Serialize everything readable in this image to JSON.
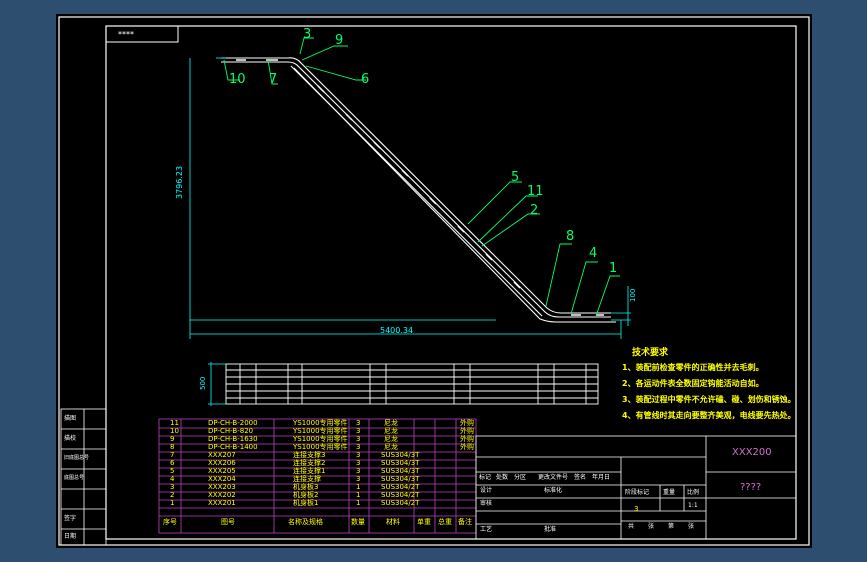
{
  "title_strip": "****",
  "dimensions": {
    "height": "3796.23",
    "length": "5400.34",
    "small_height": "100",
    "width": "500"
  },
  "balloons": [
    "3",
    "9",
    "6",
    "10",
    "7",
    "5",
    "11",
    "2",
    "8",
    "4",
    "1"
  ],
  "tech_requirements": {
    "title": "技术要求",
    "items": [
      "1、装配前检查零件的正确性并去毛刺。",
      "2、各运动件表全数固定钩能活动自如。",
      "3、装配过程中零件不允许磕、碰、划伤和锈蚀。",
      "4、有管线时其走向要整齐美观，电线要先热处。"
    ]
  },
  "bom": {
    "rows": [
      {
        "no": "11",
        "code": "DP-CH-B-2000",
        "name": "YS1000专用零件",
        "qty": "3",
        "mat": "尼龙",
        "note": "外购"
      },
      {
        "no": "10",
        "code": "DP-CH-B-820",
        "name": "YS1000专用零件",
        "qty": "3",
        "mat": "尼龙",
        "note": "外购"
      },
      {
        "no": "9",
        "code": "DP-CH-B-1630",
        "name": "YS1000专用零件",
        "qty": "3",
        "mat": "尼龙",
        "note": "外购"
      },
      {
        "no": "8",
        "code": "DP-CH-B-1400",
        "name": "YS1000专用零件",
        "qty": "3",
        "mat": "尼龙",
        "note": "外购"
      },
      {
        "no": "7",
        "code": "XXX207",
        "name": "连接支撑3",
        "qty": "3",
        "mat": "SUS304/3T",
        "note": ""
      },
      {
        "no": "6",
        "code": "XXX206",
        "name": "连接支撑2",
        "qty": "3",
        "mat": "SUS304/3T",
        "note": ""
      },
      {
        "no": "5",
        "code": "XXX205",
        "name": "连接支撑1",
        "qty": "3",
        "mat": "SUS304/3T",
        "note": ""
      },
      {
        "no": "4",
        "code": "XXX204",
        "name": "连接支撑",
        "qty": "3",
        "mat": "SUS304/3T",
        "note": ""
      },
      {
        "no": "3",
        "code": "XXX203",
        "name": "机身板3",
        "qty": "1",
        "mat": "SUS304/2T",
        "note": ""
      },
      {
        "no": "2",
        "code": "XXX202",
        "name": "机身板2",
        "qty": "1",
        "mat": "SUS304/2T",
        "note": ""
      },
      {
        "no": "1",
        "code": "XXX201",
        "name": "机身板1",
        "qty": "1",
        "mat": "SUS304/2T",
        "note": ""
      }
    ],
    "headers": [
      "序号",
      "图号",
      "名称及规格",
      "数量",
      "材料",
      "单重",
      "总重",
      "备注"
    ]
  },
  "title_block": {
    "drawing_no": "XXX200",
    "name": "????",
    "rev_row": [
      "标记",
      "处数",
      "分区",
      "更改文件号",
      "签名",
      "年月日"
    ],
    "labels": [
      "设计",
      "标准化",
      "阶段标记",
      "重量",
      "比例",
      "审核",
      "工艺",
      "批准"
    ],
    "stage_value": "3",
    "scale": "1:1",
    "sheet_row": [
      "共",
      "张",
      "第",
      "张"
    ]
  },
  "left_strip": [
    "描图",
    "描校",
    "旧底图总号",
    "底图总号",
    "签字",
    "日期"
  ],
  "colors": {
    "frame": "#ffffff",
    "geometry": "#ffffff",
    "dims": "#00ffff",
    "leaders": "#00ff66",
    "table_lines": "#c040c0",
    "text": "#ffff00",
    "title": "#d070d0"
  }
}
